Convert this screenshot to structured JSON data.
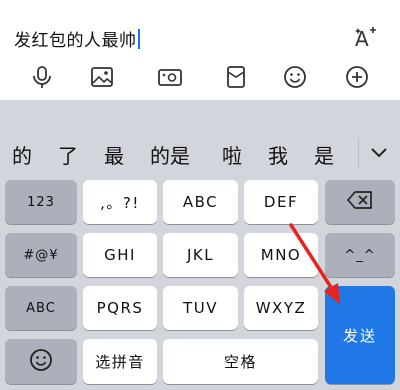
{
  "input": {
    "text": "发红包的人最帅"
  },
  "toolbar": {
    "icons": [
      "font-style-icon",
      "microphone-icon",
      "image-icon",
      "camera-icon",
      "envelope-icon",
      "emoji-icon",
      "plus-circle-icon"
    ]
  },
  "candidates": {
    "items": [
      "的",
      "了",
      "最",
      "的是",
      "啦",
      "我",
      "是"
    ],
    "expand_icon": "chevron-down-icon"
  },
  "keys": {
    "k123": "123",
    "punct": ",。?!",
    "abc": "ABC",
    "def": "DEF",
    "backspace_icon": "backspace-icon",
    "symbols": "#@¥",
    "ghi": "GHI",
    "jkl": "JKL",
    "mno": "MNO",
    "emoticon": "^_^",
    "abc_mode": "ABC",
    "pqrs": "PQRS",
    "tuv": "TUV",
    "wxyz": "WXYZ",
    "send": "发送",
    "emoji_icon": "smiley-icon",
    "pinyin": "选拼音",
    "space": "空格"
  },
  "colors": {
    "send_key": "#1f78e6",
    "annotation_arrow": "#e8231f",
    "caret": "#1a73e8"
  }
}
